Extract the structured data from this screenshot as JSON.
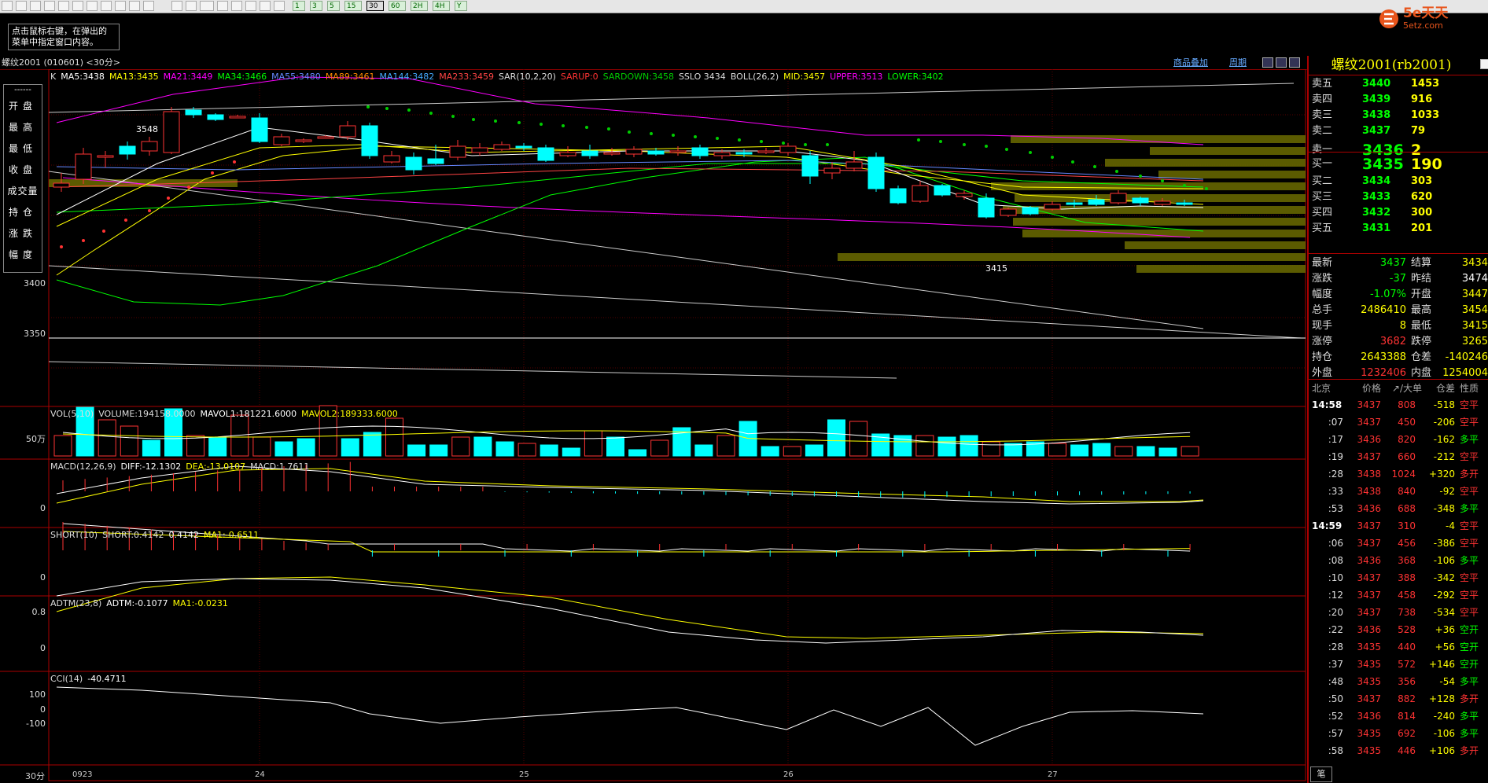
{
  "toolbar": {
    "periods": [
      "1",
      "3",
      "5",
      "15",
      "30",
      "60",
      "2H",
      "4H",
      "Y"
    ],
    "active_period": "30"
  },
  "hint": {
    "line1": "点击鼠标右键，在弹出的",
    "line2": "菜单中指定窗口内容。"
  },
  "logo": {
    "brand": "5e天天",
    "site": "5etz.com"
  },
  "title": "螺纹2001 (010601) <30分>",
  "links": {
    "overlay": "商品叠加",
    "period": "周期"
  },
  "legend_box": {
    "dash": "------",
    "items": [
      "开盘",
      "最高",
      "最低",
      "收盘",
      "成交量",
      "持仓",
      "涨跌",
      "幅度"
    ]
  },
  "kline_indicators": [
    {
      "text": "K",
      "color": "#dddddd"
    },
    {
      "text": "MA5:3438",
      "color": "#ffffff"
    },
    {
      "text": "MA13:3435",
      "color": "#ffff00"
    },
    {
      "text": "MA21:3449",
      "color": "#ff00ff"
    },
    {
      "text": "MA34:3466",
      "color": "#00ff00"
    },
    {
      "text": "MA55:3480",
      "color": "#6688ff"
    },
    {
      "text": "MA89:3461",
      "color": "#ff8800"
    },
    {
      "text": "MA144:3482",
      "color": "#44aaff"
    },
    {
      "text": "MA233:3459",
      "color": "#ff4444"
    },
    {
      "text": "SAR(10,2,20)",
      "color": "#dddddd"
    },
    {
      "text": "SARUP:0",
      "color": "#ff3333"
    },
    {
      "text": "SARDOWN:3458",
      "color": "#00cc00"
    },
    {
      "text": "SSLO 3434",
      "color": "#dddddd"
    },
    {
      "text": "BOLL(26,2)",
      "color": "#dddddd"
    },
    {
      "text": "MID:3457",
      "color": "#ffff00"
    },
    {
      "text": "UPPER:3513",
      "color": "#ff00ff"
    },
    {
      "text": "LOWER:3402",
      "color": "#00ff00"
    }
  ],
  "annotations": {
    "high": "3548",
    "low": "3415"
  },
  "y_labels": {
    "price": [
      "3400",
      "3350"
    ],
    "vol": "50万",
    "macd": "0",
    "short": "0",
    "adtm": [
      "0.8",
      "0"
    ],
    "cci": [
      "100",
      "0",
      "-100"
    ]
  },
  "vol_indicators": [
    {
      "text": "VOL(5,10)",
      "color": "#dddddd"
    },
    {
      "text": "VOLUME:194158.0000",
      "color": "#dddddd"
    },
    {
      "text": "MAVOL1:181221.6000",
      "color": "#ffffff"
    },
    {
      "text": "MAVOL2:189333.6000",
      "color": "#ffff00"
    }
  ],
  "macd_indicators": [
    {
      "text": "MACD(12,26,9)",
      "color": "#dddddd"
    },
    {
      "text": "DIFF:-12.1302",
      "color": "#ffffff"
    },
    {
      "text": "DEA:-13.0107",
      "color": "#ffff00"
    },
    {
      "text": "MACD:1.7611",
      "color": "#dddddd"
    }
  ],
  "short_indicators": [
    {
      "text": "SHORT(10)",
      "color": "#dddddd"
    },
    {
      "text": "SHORT:0.4142",
      "color": "#dddddd"
    },
    {
      "text": "0.4142",
      "color": "#ffffff"
    },
    {
      "text": "MA1:-0.6511",
      "color": "#ffff00"
    }
  ],
  "adtm_indicators": [
    {
      "text": "ADTM(23,8)",
      "color": "#dddddd"
    },
    {
      "text": "ADTM:-0.1077",
      "color": "#ffffff"
    },
    {
      "text": "MA1:-0.0231",
      "color": "#ffff00"
    }
  ],
  "cci_indicators": [
    {
      "text": "CCI(14)",
      "color": "#dddddd"
    },
    {
      "text": "-40.4711",
      "color": "#ffffff"
    }
  ],
  "x_axis": {
    "period": "30分",
    "labels": [
      "0923",
      "24",
      "25",
      "26",
      "27"
    ]
  },
  "right_panel": {
    "title": "螺纹2001(rb2001)",
    "asks": [
      {
        "label": "卖五",
        "price": "3440",
        "vol": "1453"
      },
      {
        "label": "卖四",
        "price": "3439",
        "vol": "916"
      },
      {
        "label": "卖三",
        "price": "3438",
        "vol": "1033"
      },
      {
        "label": "卖二",
        "price": "3437",
        "vol": "79"
      },
      {
        "label": "卖一",
        "price": "3436",
        "vol": "2"
      }
    ],
    "bids": [
      {
        "label": "买一",
        "price": "3435",
        "vol": "190"
      },
      {
        "label": "买二",
        "price": "3434",
        "vol": "303"
      },
      {
        "label": "买三",
        "price": "3433",
        "vol": "620"
      },
      {
        "label": "买四",
        "price": "3432",
        "vol": "300"
      },
      {
        "label": "买五",
        "price": "3431",
        "vol": "201"
      }
    ],
    "quote": [
      {
        "l1": "最新",
        "v1": "3437",
        "c1": "#00ff00",
        "l2": "结算",
        "v2": "3434",
        "c2": "#ffff00"
      },
      {
        "l1": "涨跌",
        "v1": "-37",
        "c1": "#00ff00",
        "l2": "昨结",
        "v2": "3474",
        "c2": "#ffffff"
      },
      {
        "l1": "幅度",
        "v1": "-1.07%",
        "c1": "#00ff00",
        "l2": "开盘",
        "v2": "3447",
        "c2": "#ffff00"
      },
      {
        "l1": "总手",
        "v1": "2486410",
        "c1": "#ffff00",
        "l2": "最高",
        "v2": "3454",
        "c2": "#ffff00"
      },
      {
        "l1": "现手",
        "v1": "8",
        "c1": "#ffff00",
        "l2": "最低",
        "v2": "3415",
        "c2": "#ffff00"
      },
      {
        "l1": "涨停",
        "v1": "3682",
        "c1": "#ff3333",
        "l2": "跌停",
        "v2": "3265",
        "c2": "#ffff00"
      },
      {
        "l1": "持仓",
        "v1": "2643388",
        "c1": "#ffff00",
        "l2": "仓差",
        "v2": "-140246",
        "c2": "#ffff00"
      },
      {
        "l1": "外盘",
        "v1": "1232406",
        "c1": "#ff3333",
        "l2": "内盘",
        "v2": "1254004",
        "c2": "#ffff00"
      }
    ],
    "tick_header": {
      "time": "北京",
      "price": "价格",
      "vol": "↗/大单",
      "oi": "仓差",
      "type": "性质"
    },
    "ticks": [
      {
        "time": "14:58",
        "price": "3437",
        "vol": "808",
        "oi": "-518",
        "type": "空平",
        "tc": "#ff3333"
      },
      {
        "time": ":07",
        "price": "3437",
        "vol": "450",
        "oi": "-206",
        "type": "空平",
        "tc": "#ff3333"
      },
      {
        "time": ":17",
        "price": "3436",
        "vol": "820",
        "oi": "-162",
        "type": "多平",
        "tc": "#00ff00"
      },
      {
        "time": ":19",
        "price": "3437",
        "vol": "660",
        "oi": "-212",
        "type": "空平",
        "tc": "#ff3333"
      },
      {
        "time": ":28",
        "price": "3438",
        "vol": "1024",
        "oi": "+320",
        "type": "多开",
        "tc": "#ff3333"
      },
      {
        "time": ":33",
        "price": "3438",
        "vol": "840",
        "oi": "-92",
        "type": "空平",
        "tc": "#ff3333"
      },
      {
        "time": ":53",
        "price": "3436",
        "vol": "688",
        "oi": "-348",
        "type": "多平",
        "tc": "#00ff00"
      },
      {
        "time": "14:59",
        "price": "3437",
        "vol": "310",
        "oi": "-4",
        "type": "空平",
        "tc": "#ff3333"
      },
      {
        "time": ":06",
        "price": "3437",
        "vol": "456",
        "oi": "-386",
        "type": "空平",
        "tc": "#ff3333"
      },
      {
        "time": ":08",
        "price": "3436",
        "vol": "368",
        "oi": "-106",
        "type": "多平",
        "tc": "#00ff00"
      },
      {
        "time": ":10",
        "price": "3437",
        "vol": "388",
        "oi": "-342",
        "type": "空平",
        "tc": "#ff3333"
      },
      {
        "time": ":12",
        "price": "3437",
        "vol": "458",
        "oi": "-292",
        "type": "空平",
        "tc": "#ff3333"
      },
      {
        "time": ":20",
        "price": "3437",
        "vol": "738",
        "oi": "-534",
        "type": "空平",
        "tc": "#ff3333"
      },
      {
        "time": ":22",
        "price": "3436",
        "vol": "528",
        "oi": "+36",
        "type": "空开",
        "tc": "#00ff00"
      },
      {
        "time": ":28",
        "price": "3435",
        "vol": "440",
        "oi": "+56",
        "type": "空开",
        "tc": "#00ff00"
      },
      {
        "time": ":37",
        "price": "3435",
        "vol": "572",
        "oi": "+146",
        "type": "空开",
        "tc": "#00ff00"
      },
      {
        "time": ":48",
        "price": "3435",
        "vol": "356",
        "oi": "-54",
        "type": "多平",
        "tc": "#00ff00"
      },
      {
        "time": ":50",
        "price": "3437",
        "vol": "882",
        "oi": "+128",
        "type": "多开",
        "tc": "#ff3333"
      },
      {
        "time": ":52",
        "price": "3436",
        "vol": "814",
        "oi": "-240",
        "type": "多平",
        "tc": "#00ff00"
      },
      {
        "time": ":57",
        "price": "3435",
        "vol": "692",
        "oi": "-106",
        "type": "多平",
        "tc": "#00ff00"
      },
      {
        "time": ":58",
        "price": "3435",
        "vol": "446",
        "oi": "+106",
        "type": "多开",
        "tc": "#ff3333"
      }
    ],
    "bottom_tab": "笔"
  }
}
